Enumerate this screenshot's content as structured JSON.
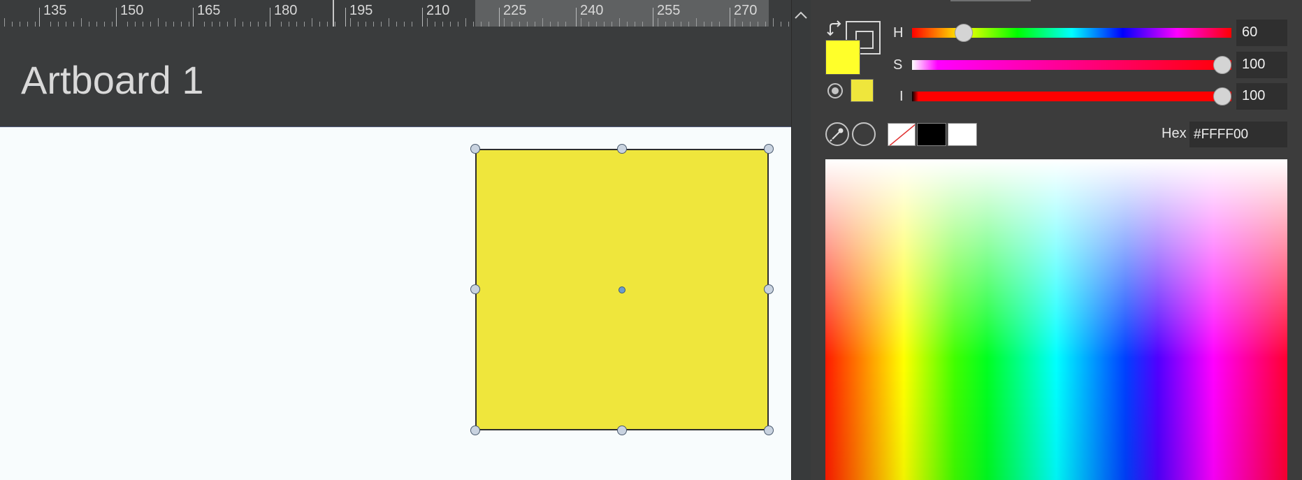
{
  "ruler": {
    "labels": [
      "135",
      "150",
      "165",
      "180",
      "195",
      "210",
      "225",
      "240",
      "255",
      "270"
    ]
  },
  "artboard": {
    "title": "Artboard 1"
  },
  "shape": {
    "fill": "#EFE63C",
    "stroke": "#2D2D2D"
  },
  "color_panel": {
    "h_label": "H",
    "s_label": "S",
    "i_label": "I",
    "h_value": "60",
    "s_value": "100",
    "i_value": "100",
    "h_fraction": 0.167,
    "s_fraction": 1.0,
    "i_fraction": 1.0,
    "hex_label": "Hex",
    "hex_value": "#FFFF00",
    "fill_color": "#FFFF2A",
    "current_color": "#EFE63C",
    "icons": [
      "swap-icon",
      "stroke-icon",
      "radio-icon",
      "eyedropper-icon",
      "circle-icon",
      "chevron-up-icon"
    ]
  }
}
